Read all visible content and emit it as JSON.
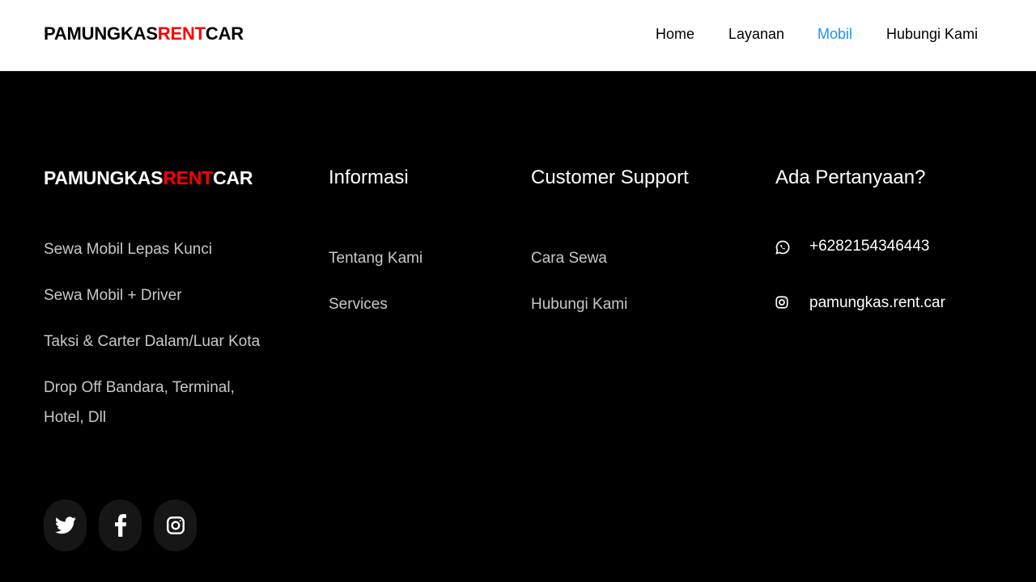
{
  "header": {
    "brand": {
      "part1": "PAMUNGKAS",
      "part2": "RENT",
      "part3": "CAR"
    },
    "nav": [
      {
        "label": "Home",
        "active": false
      },
      {
        "label": "Layanan",
        "active": false
      },
      {
        "label": "Mobil",
        "active": true
      },
      {
        "label": "Hubungi Kami",
        "active": false
      }
    ]
  },
  "footer": {
    "brand": {
      "part1": "PAMUNGKAS",
      "part2": "RENT",
      "part3": "CAR"
    },
    "services": [
      "Sewa Mobil Lepas Kunci",
      "Sewa Mobil + Driver",
      "Taksi & Carter Dalam/Luar Kota",
      "Drop Off Bandara, Terminal, Hotel, Dll"
    ],
    "informasi": {
      "title": "Informasi",
      "links": [
        "Tentang Kami",
        "Services"
      ]
    },
    "support": {
      "title": "Customer Support",
      "links": [
        "Cara Sewa",
        "Hubungi Kami"
      ]
    },
    "questions": {
      "title": "Ada Pertanyaan?",
      "phone": "+6282154346443",
      "phone_icon": "whatsapp-icon",
      "instagram": "pamungkas.rent.car",
      "instagram_icon": "instagram-icon"
    },
    "social": [
      {
        "icon": "twitter-icon"
      },
      {
        "icon": "facebook-icon"
      },
      {
        "icon": "instagram-icon"
      }
    ]
  },
  "colors": {
    "accent": "#ff0000",
    "active_link": "#1e90ff",
    "footer_bg": "#000000",
    "header_bg": "#ffffff"
  }
}
